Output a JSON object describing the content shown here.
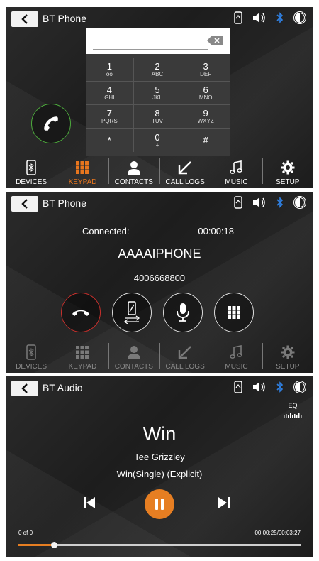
{
  "phone_keypad": {
    "title": "BT Phone",
    "keys": [
      {
        "num": "1",
        "sub": "oo"
      },
      {
        "num": "2",
        "sub": "ABC"
      },
      {
        "num": "3",
        "sub": "DEF"
      },
      {
        "num": "4",
        "sub": "GHI"
      },
      {
        "num": "5",
        "sub": "JKL"
      },
      {
        "num": "6",
        "sub": "MNO"
      },
      {
        "num": "7",
        "sub": "PQRS"
      },
      {
        "num": "8",
        "sub": "TUV"
      },
      {
        "num": "9",
        "sub": "WXYZ"
      },
      {
        "num": "*",
        "sub": ""
      },
      {
        "num": "0",
        "sub": "+"
      },
      {
        "num": "#",
        "sub": ""
      }
    ],
    "nav": [
      {
        "label": "DEVICES",
        "icon": "phone-device-icon"
      },
      {
        "label": "KEYPAD",
        "icon": "keypad-grid-icon",
        "active": true
      },
      {
        "label": "CONTACTS",
        "icon": "person-icon"
      },
      {
        "label": "CALL LOGS",
        "icon": "call-log-arrow-icon"
      },
      {
        "label": "MUSIC",
        "icon": "music-note-icon"
      },
      {
        "label": "SETUP",
        "icon": "gear-icon"
      }
    ]
  },
  "phone_call": {
    "title": "BT Phone",
    "status": "Connected:",
    "timer": "00:00:18",
    "caller_name": "AAAAIPHONE",
    "caller_number": "4006668800",
    "nav": [
      {
        "label": "DEVICES"
      },
      {
        "label": "KEYPAD"
      },
      {
        "label": "CONTACTS"
      },
      {
        "label": "CALL LOGS"
      },
      {
        "label": "MUSIC"
      },
      {
        "label": "SETUP"
      }
    ]
  },
  "bt_audio": {
    "title": "BT Audio",
    "eq_label": "EQ",
    "track": "Win",
    "artist": "Tee Grizzley",
    "album": "Win(Single) (Explicit)",
    "track_count": "0 of 0",
    "time": "00:00:25/00:03:27",
    "progress_fraction": 0.125
  },
  "colors": {
    "accent": "#e8761e",
    "answer_green": "#4caa3c",
    "end_red": "#c9302c",
    "bluetooth": "#2f7fe0"
  }
}
